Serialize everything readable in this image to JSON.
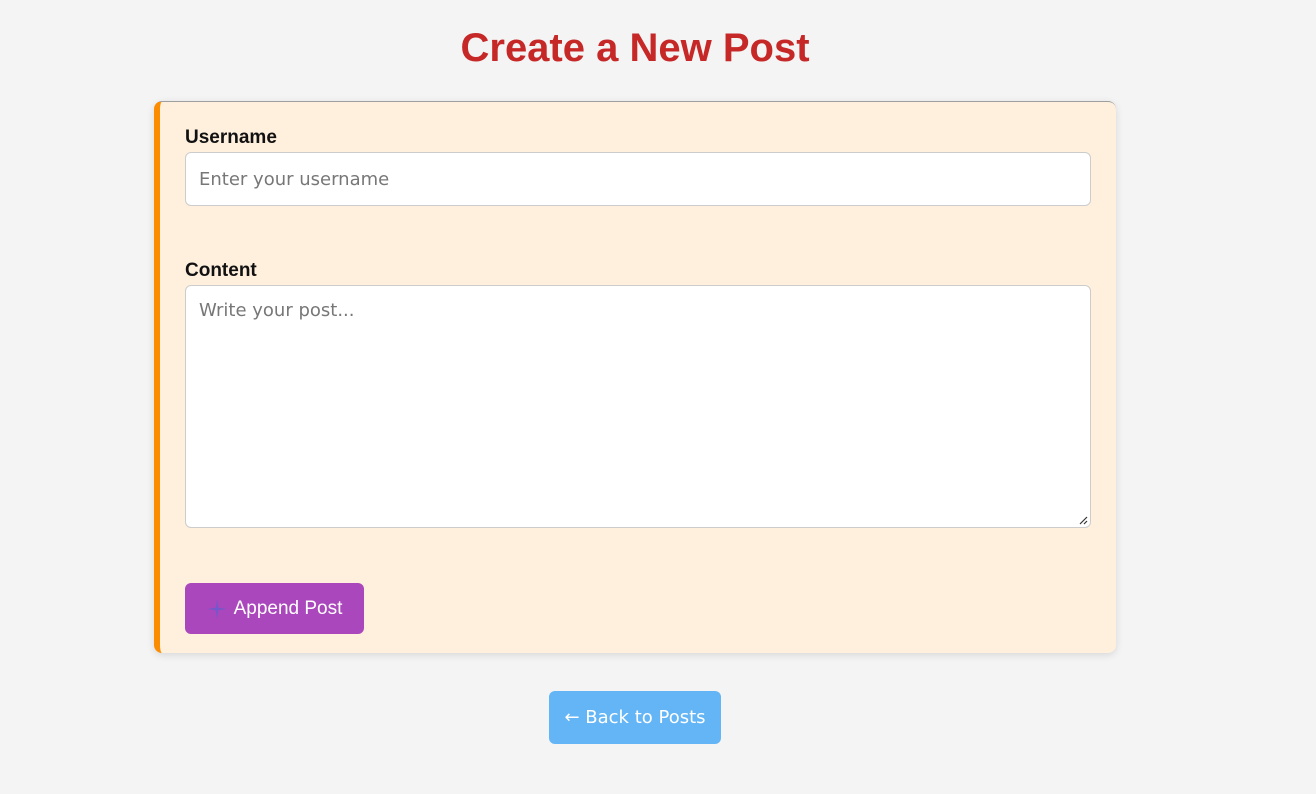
{
  "page": {
    "title": "Create a New Post"
  },
  "form": {
    "username_label": "Username",
    "username_placeholder": "Enter your username",
    "username_value": "",
    "content_label": "Content",
    "content_placeholder": "Write your post...",
    "content_value": "",
    "append_button_label": "Append Post",
    "append_button_icon": "sparkle-icon"
  },
  "navigation": {
    "back_label": "← Back to Posts"
  },
  "colors": {
    "title": "#c62828",
    "card_background": "#fff0de",
    "card_accent": "#fb8c00",
    "append_button": "#ab47bc",
    "back_button": "#64b5f6",
    "page_background": "#f4f4f4"
  }
}
